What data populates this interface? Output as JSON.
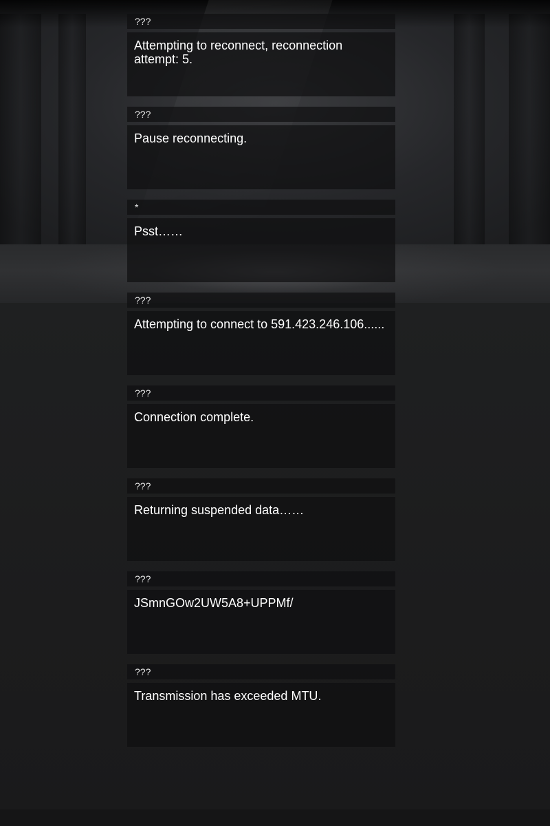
{
  "log": {
    "entries": [
      {
        "speaker": "???",
        "text": "Attempting to reconnect, reconnection attempt: 5."
      },
      {
        "speaker": "???",
        "text": "Pause reconnecting."
      },
      {
        "speaker": "*",
        "text": "Psst……"
      },
      {
        "speaker": "???",
        "text": "Attempting to connect to 591.423.246.106......"
      },
      {
        "speaker": "???",
        "text": "Connection complete."
      },
      {
        "speaker": "???",
        "text": "Returning suspended data……"
      },
      {
        "speaker": "???",
        "text": "JSmnGOw2UW5A8+UPPMf/"
      },
      {
        "speaker": "???",
        "text": "Transmission has exceeded MTU."
      }
    ]
  }
}
